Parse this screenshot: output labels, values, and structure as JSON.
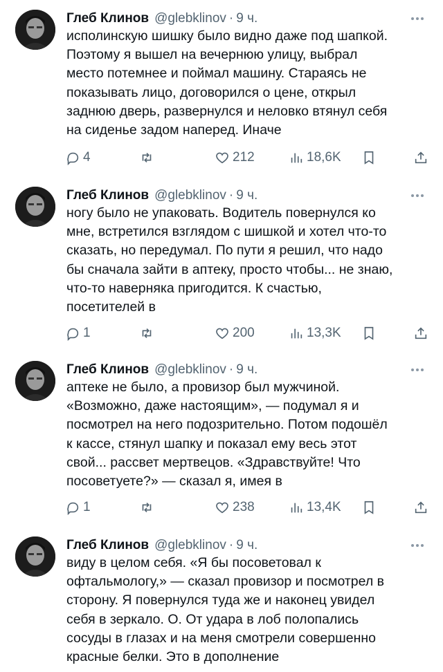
{
  "tweets": [
    {
      "author": "Глеб Клинов",
      "handle": "@glebklinov",
      "separator": "·",
      "time": "9 ч.",
      "lines": [
        "исполинскую шишку было видно даже под шапкой.",
        "Поэтому я вышел на вечернюю улицу, выбрал",
        "место потемнее и поймал машину. Стараясь не",
        "показывать лицо, договорился о цене, открыл",
        "заднюю дверь, развернулся и неловко втянул себя",
        "на сиденье задом наперед. Иначе"
      ],
      "replies": "4",
      "likes": "212",
      "views": "18,6K"
    },
    {
      "author": "Глеб Клинов",
      "handle": "@glebklinov",
      "separator": "·",
      "time": "9 ч.",
      "lines": [
        "ногу было не упаковать. Водитель повернулся ко",
        "мне, встретился взглядом с шишкой и хотел что-то",
        "сказать, но передумал. По пути я решил, что надо",
        "бы сначала зайти в аптеку, просто чтобы... не знаю,",
        "что-то наверняка пригодится. К счастью,",
        "посетителей в"
      ],
      "replies": "1",
      "likes": "200",
      "views": "13,3K"
    },
    {
      "author": "Глеб Клинов",
      "handle": "@glebklinov",
      "separator": "·",
      "time": "9 ч.",
      "lines": [
        "аптеке не было, а провизор был мужчиной.",
        "«Возможно, даже настоящим», — подумал я и",
        "посмотрел на него подозрительно. Потом подошёл",
        "к кассе, стянул шапку и показал ему весь этот",
        "свой... рассвет мертвецов. «Здравствуйте! Что",
        "посоветуете?» — сказал я, имея в"
      ],
      "replies": "1",
      "likes": "238",
      "views": "13,4K"
    },
    {
      "author": "Глеб Клинов",
      "handle": "@glebklinov",
      "separator": "·",
      "time": "9 ч.",
      "lines": [
        "виду в целом себя. «Я бы посоветовал к",
        "офтальмологу,» — сказал провизор и посмотрел в",
        "сторону. Я повернулся туда же и наконец увидел",
        "себя в зеркало. О. От удара в лоб полопались",
        "сосуды в глазах и на меня смотрели совершенно",
        "красные белки. Это в дополнение"
      ]
    }
  ],
  "icons": {
    "reply": "speech-bubble-icon",
    "retweet": "retweet-arrows-icon",
    "like": "heart-icon",
    "views": "bar-chart-icon",
    "bookmark": "bookmark-icon",
    "share": "share-upload-icon",
    "more": "more-dots-icon"
  },
  "colors": {
    "text": "#0f1419",
    "secondary": "#536471",
    "background": "#ffffff"
  }
}
